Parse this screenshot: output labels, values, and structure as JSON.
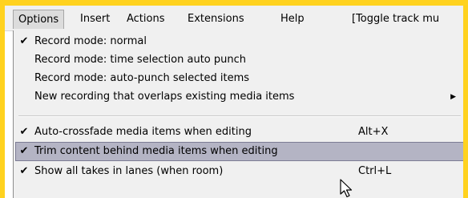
{
  "menubar": {
    "items": [
      {
        "label": "Options"
      },
      {
        "label": "Insert"
      },
      {
        "label": "Actions"
      },
      {
        "label": "Extensions"
      },
      {
        "label": "Help"
      },
      {
        "label": "[Toggle track mu"
      }
    ]
  },
  "dropdown": {
    "items": [
      {
        "label": "Record mode: normal",
        "checked": true,
        "check_mark": "✔"
      },
      {
        "label": "Record mode: time selection auto punch",
        "checked": false
      },
      {
        "label": "Record mode: auto-punch selected items",
        "checked": false
      },
      {
        "label": "New recording that overlaps existing media items",
        "checked": false,
        "submenu": true,
        "submenu_arrow": "▶"
      },
      {
        "label": "Auto-crossfade media items when editing",
        "checked": true,
        "check_mark": "✔",
        "shortcut": "Alt+X"
      },
      {
        "label": "Trim content behind media items when editing",
        "checked": true,
        "check_mark": "✔",
        "highlighted": true
      },
      {
        "label": "Show all takes in lanes (when room)",
        "checked": true,
        "check_mark": "✔",
        "shortcut": "Ctrl+L"
      }
    ]
  },
  "colors": {
    "frame": "#ffd21f",
    "highlight": "#b4b4c4",
    "menu_bg": "#f0f0f0"
  },
  "icons": {
    "check": "checkmark-icon",
    "submenu": "submenu-arrow-icon",
    "cursor": "mouse-pointer-icon"
  }
}
